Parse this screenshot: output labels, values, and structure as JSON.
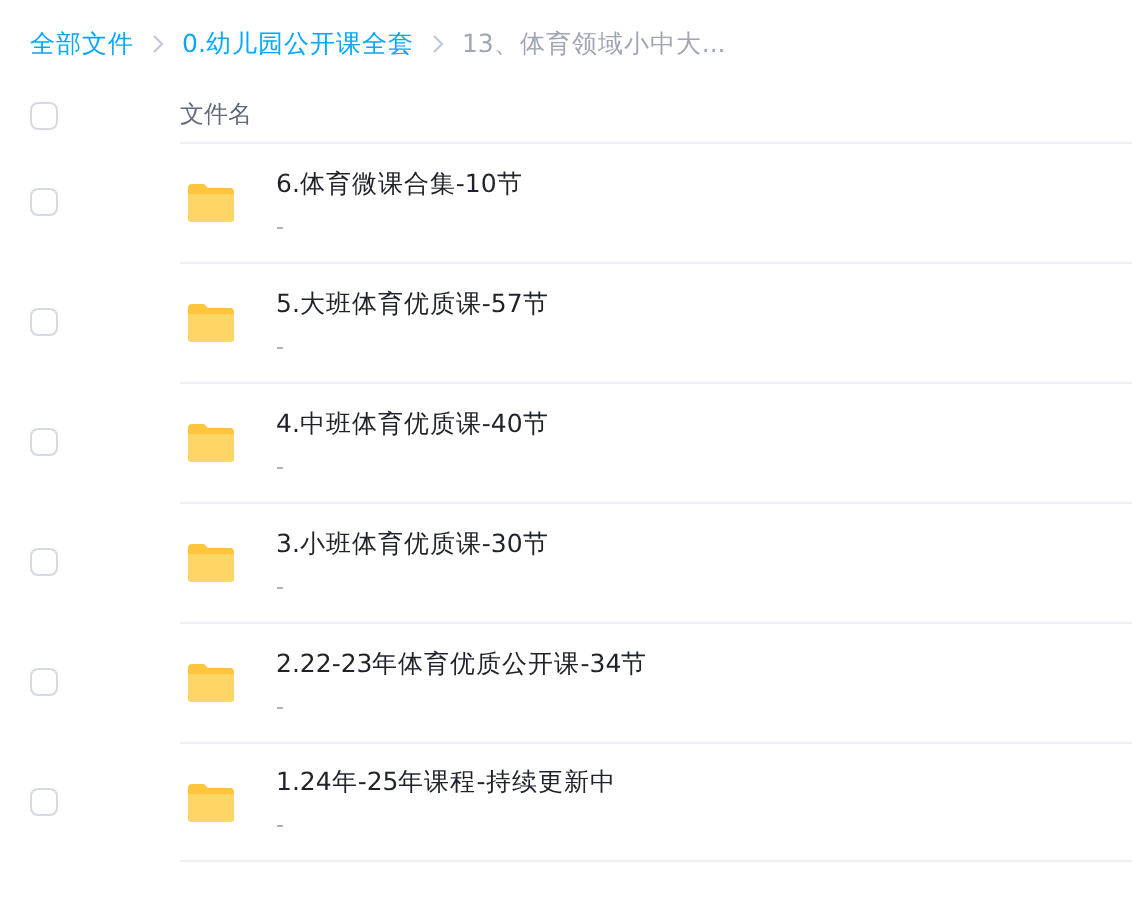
{
  "breadcrumb": [
    {
      "label": "全部文件",
      "current": false
    },
    {
      "label": "0.幼儿园公开课全套",
      "current": false
    },
    {
      "label": "13、体育领域小中大...",
      "current": true
    }
  ],
  "table": {
    "column": "文件名",
    "all_checked": false,
    "rows": [
      {
        "name": "6.体育微课合集-10节",
        "detail": "-",
        "checked": false
      },
      {
        "name": "5.大班体育优质课-57节",
        "detail": "-",
        "checked": false
      },
      {
        "name": "4.中班体育优质课-40节",
        "detail": "-",
        "checked": false
      },
      {
        "name": "3.小班体育优质课-30节",
        "detail": "-",
        "checked": false
      },
      {
        "name": "2.22-23年体育优质公开课-34节",
        "detail": "-",
        "checked": false
      },
      {
        "name": "1.24年-25年课程-持续更新中",
        "detail": "-",
        "checked": false
      }
    ]
  }
}
